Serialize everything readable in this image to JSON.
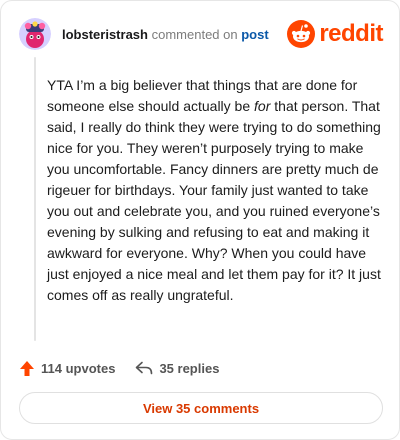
{
  "comment": {
    "username": "lobsteristrash",
    "action_text": "commented on",
    "target_text": "post",
    "body_part1": "YTA I’m a big believer that things that are done for someone else should actually be ",
    "body_emphasis": "for",
    "body_part2": " that person. That said, I really do think they were trying to do something nice for you. They weren’t purposely trying to make you uncomfortable. Fancy dinners are pretty much de rigeuer for birthdays. Your family just wanted to take you out and celebrate you, and you ruined everyone’s evening by sulking and refusing to eat and making it awkward for everyone. Why? When you could have just enjoyed a nice meal and let them pay for it? It just comes off as really ungrateful."
  },
  "brand": {
    "name": "reddit",
    "icon": "reddit-logo-icon",
    "color": "#ff4500"
  },
  "stats": {
    "upvotes_label": "114 upvotes",
    "upvote_icon": "upvote-arrow-icon",
    "upvote_color": "#ff4500",
    "replies_label": "35 replies",
    "reply_icon": "reply-arrow-icon"
  },
  "footer": {
    "view_comments_label": "View 35 comments",
    "accent": "#d93900"
  }
}
